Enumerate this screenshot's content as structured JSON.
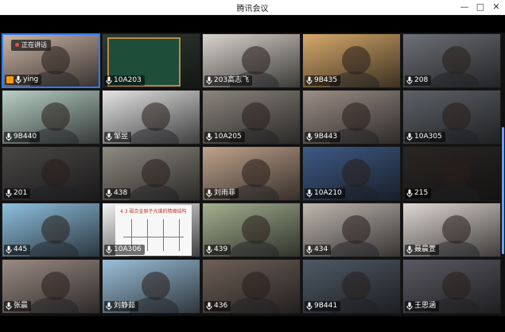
{
  "window": {
    "title": "腾讯会议",
    "min_icon": "minimize-icon",
    "max_icon": "maximize-icon",
    "close_icon": "close-icon"
  },
  "speaking_label": "正在讲话",
  "colors": {
    "active_border": "#2f7cf6",
    "tag_bg": "rgba(0,0,0,0.55)",
    "speaking_dot": "#e74c3c"
  },
  "tiles": [
    {
      "label": "ying",
      "bg": "#c9b3a4",
      "active": true,
      "speaking": true,
      "badge": "person-icon"
    },
    {
      "label": "10A203",
      "bg": "#2f3b30",
      "active": false,
      "board": true
    },
    {
      "label": "203高志飞",
      "bg": "#d9d4cc"
    },
    {
      "label": "9B435",
      "bg": "#d6a96a"
    },
    {
      "label": "208",
      "bg": "#6d7077"
    },
    {
      "label": "9B440",
      "bg": "#b8d0c6"
    },
    {
      "label": "邹昱",
      "bg": "#e4e4e4"
    },
    {
      "label": "10A205",
      "bg": "#8b857c"
    },
    {
      "label": "9B443",
      "bg": "#9c8e86"
    },
    {
      "label": "10A305",
      "bg": "#5e6268"
    },
    {
      "label": "201",
      "bg": "#4a4646"
    },
    {
      "label": "438",
      "bg": "#8e8a80"
    },
    {
      "label": "刘雨菲",
      "bg": "#bfa38c"
    },
    {
      "label": "10A210",
      "bg": "#3e5a86"
    },
    {
      "label": "215",
      "bg": "#2a2624"
    },
    {
      "label": "445",
      "bg": "#8ec0e0"
    },
    {
      "label": "10A306",
      "bg": "#f2f2f2",
      "slide": true
    },
    {
      "label": "439",
      "bg": "#a4b090"
    },
    {
      "label": "434",
      "bg": "#c0b8b0"
    },
    {
      "label": "聂晨萱",
      "bg": "#e0d8d2"
    },
    {
      "label": "张晨",
      "bg": "#9b8b84"
    },
    {
      "label": "刘静茹",
      "bg": "#9cc0da"
    },
    {
      "label": "436",
      "bg": "#6e6058"
    },
    {
      "label": "9B441",
      "bg": "#4f5a66"
    },
    {
      "label": "王思涵",
      "bg": "#5b5a64"
    }
  ],
  "slide": {
    "title": "4.3 磁合金原子光谱的精细结构"
  }
}
